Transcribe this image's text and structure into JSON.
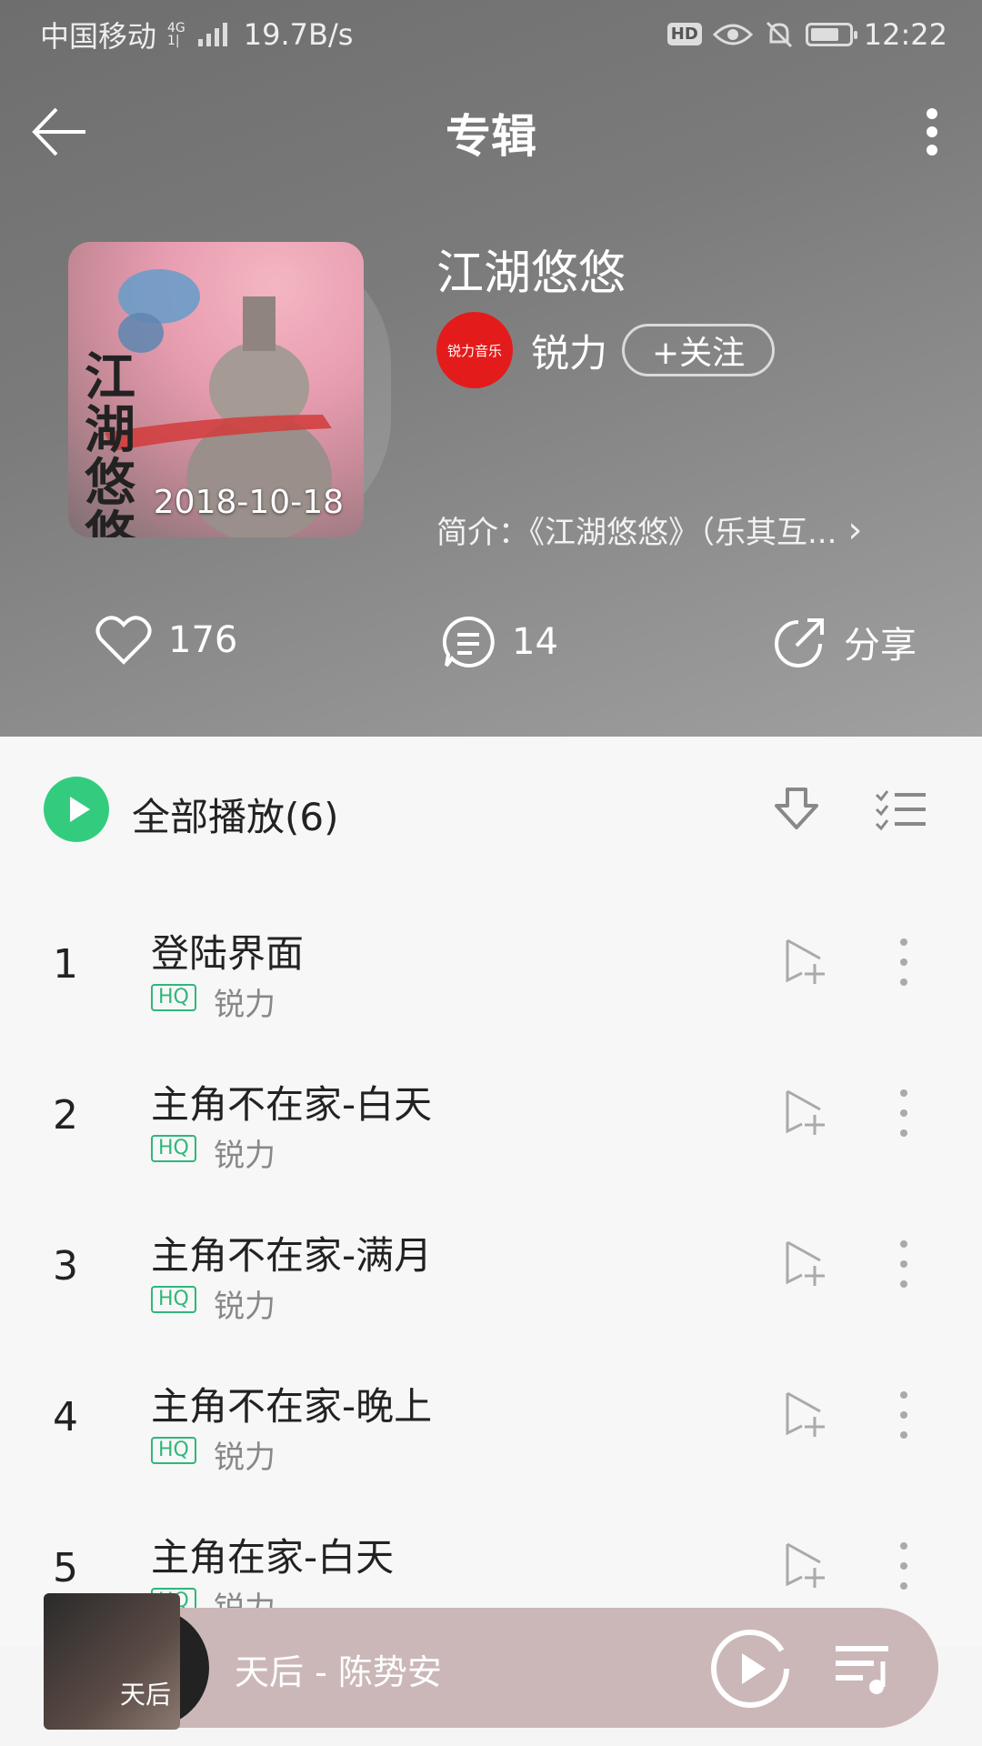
{
  "status": {
    "carrier": "中国移动",
    "net_top": "4G",
    "net_bottom": "1|",
    "speed": "19.7B/s",
    "hd": "HD",
    "time": "12:22"
  },
  "topbar": {
    "title": "专辑"
  },
  "album": {
    "title": "江湖悠悠",
    "date": "2018-10-18",
    "cover_text": "江湖悠悠",
    "artist": "锐力",
    "label_logo_text": "锐力音乐",
    "follow_label": "+关注",
    "intro": "简介：《江湖悠悠》（乐其互...",
    "likes": "176",
    "comments": "14",
    "share_label": "分享"
  },
  "playall": {
    "label": "全部播放(6)"
  },
  "songs": [
    {
      "num": "1",
      "name": "登陆界面",
      "badge": "HQ",
      "artist": "锐力"
    },
    {
      "num": "2",
      "name": "主角不在家-白天",
      "badge": "HQ",
      "artist": "锐力"
    },
    {
      "num": "3",
      "name": "主角不在家-满月",
      "badge": "HQ",
      "artist": "锐力"
    },
    {
      "num": "4",
      "name": "主角不在家-晚上",
      "badge": "HQ",
      "artist": "锐力"
    },
    {
      "num": "5",
      "name": "主角在家-白天",
      "badge": "HQ",
      "artist": "锐力"
    }
  ],
  "mini_player": {
    "title": "天后 - 陈势安",
    "cover_text": "天后"
  },
  "colors": {
    "accent": "#33cc7f",
    "header_bg": "#7b7b7b",
    "mini_bg": "#ccb7b8"
  }
}
